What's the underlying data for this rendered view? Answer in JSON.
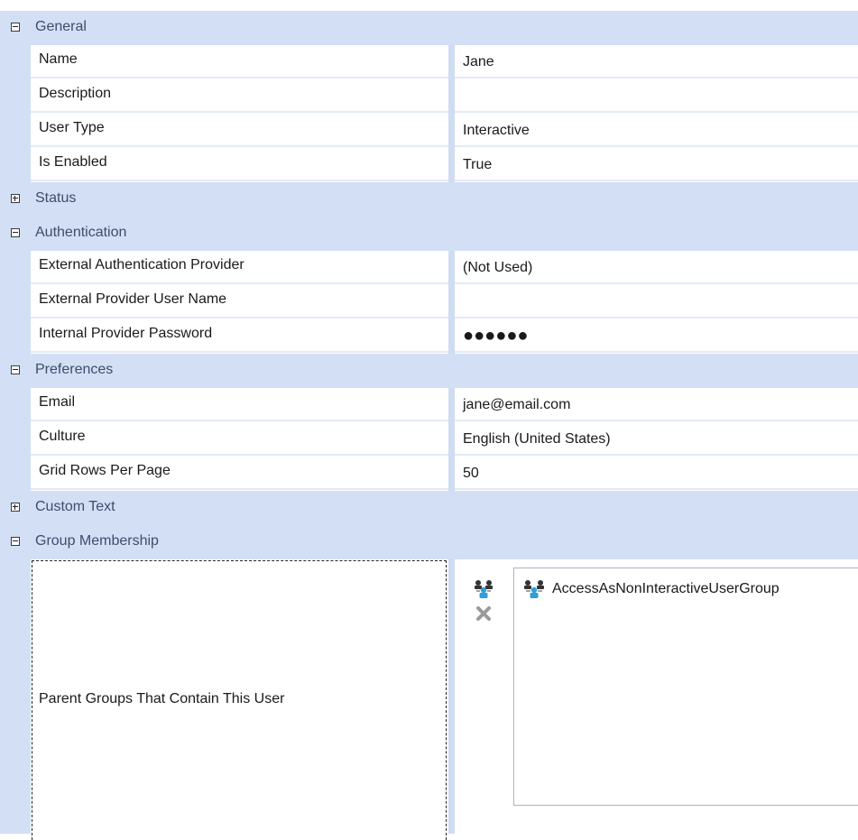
{
  "categories": {
    "general": {
      "label": "General",
      "expanded": true
    },
    "status": {
      "label": "Status",
      "expanded": false
    },
    "authentication": {
      "label": "Authentication",
      "expanded": true
    },
    "preferences": {
      "label": "Preferences",
      "expanded": true
    },
    "custom_text": {
      "label": "Custom Text",
      "expanded": false
    },
    "group_membership": {
      "label": "Group Membership",
      "expanded": true
    }
  },
  "general": {
    "name": {
      "label": "Name",
      "value": "Jane"
    },
    "description": {
      "label": "Description",
      "value": ""
    },
    "user_type": {
      "label": "User Type",
      "value": "Interactive"
    },
    "is_enabled": {
      "label": "Is Enabled",
      "value": "True"
    }
  },
  "authentication": {
    "external_provider": {
      "label": "External Authentication Provider",
      "value": "(Not Used)"
    },
    "external_user_name": {
      "label": "External Provider User Name",
      "value": ""
    },
    "internal_password": {
      "label": "Internal Provider Password",
      "value": "●●●●●●"
    }
  },
  "preferences": {
    "email": {
      "label": "Email",
      "value": "jane@email.com"
    },
    "culture": {
      "label": "Culture",
      "value": "English (United States)"
    },
    "grid_rows": {
      "label": "Grid Rows Per Page",
      "value": "50"
    }
  },
  "group_membership": {
    "label": "Parent Groups That Contain This User",
    "groups": [
      "AccessAsNonInteractiveUserGroup"
    ],
    "icons": {
      "add": "add-group-icon",
      "remove": "remove-icon",
      "group": "user-group-icon"
    }
  },
  "colors": {
    "category_bg": "#d3dff5",
    "category_text": "#3d4d6a",
    "row_separator": "#e3eaf6",
    "list_border": "#a9b3c4"
  }
}
